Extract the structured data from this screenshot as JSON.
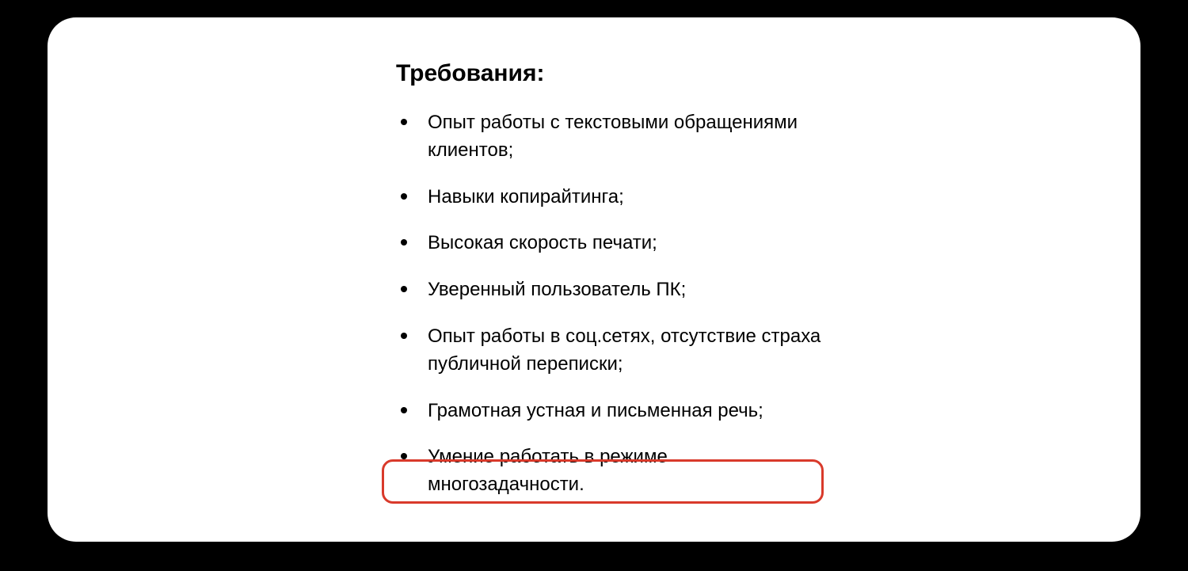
{
  "heading": "Требования:",
  "items": [
    "Опыт работы с текстовыми обращениями клиентов;",
    "Навыки копирайтинга;",
    "Высокая скорость печати;",
    "Уверенный пользователь ПК;",
    "Опыт работы в соц.сетях, отсутствие страха публичной переписки;",
    "Грамотная устная и письменная речь;",
    "Умение работать в режиме многозадачности."
  ],
  "highlight_color": "#D93A2B"
}
